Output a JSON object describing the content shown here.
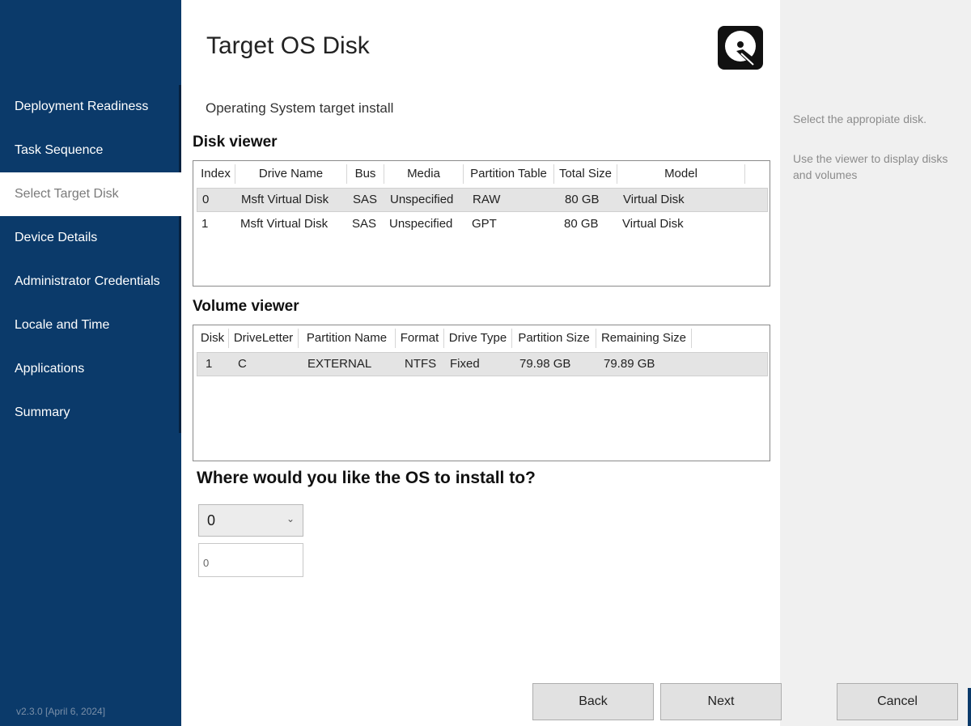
{
  "sidebar": {
    "items": [
      {
        "label": "Deployment Readiness"
      },
      {
        "label": "Task Sequence"
      },
      {
        "label": "Select Target Disk"
      },
      {
        "label": "Device Details"
      },
      {
        "label": "Administrator Credentials"
      },
      {
        "label": "Locale and Time"
      },
      {
        "label": "Applications"
      },
      {
        "label": "Summary"
      }
    ],
    "active_index": 2,
    "version": "v2.3.0 [April 6, 2024]"
  },
  "header": {
    "title": "Target OS Disk",
    "subtitle": "Operating System target install",
    "icon": "hard-disk-icon"
  },
  "disk_viewer": {
    "heading": "Disk viewer",
    "columns": [
      "Index",
      "Drive Name",
      "Bus",
      "Media",
      "Partition Table",
      "Total Size",
      "Model"
    ],
    "rows": [
      [
        "0",
        "Msft Virtual Disk",
        "SAS",
        "Unspecified",
        "RAW",
        "80 GB",
        "Virtual Disk"
      ],
      [
        "1",
        "Msft Virtual Disk",
        "SAS",
        "Unspecified",
        "GPT",
        "80 GB",
        "Virtual Disk"
      ]
    ],
    "selected_row": 0
  },
  "volume_viewer": {
    "heading": "Volume viewer",
    "columns": [
      "Disk",
      "DriveLetter",
      "Partition Name",
      "Format",
      "Drive Type",
      "Partition Size",
      "Remaining Size"
    ],
    "rows": [
      [
        "1",
        "C",
        "EXTERNAL",
        "NTFS",
        "Fixed",
        "79.98 GB",
        "79.89 GB"
      ]
    ],
    "selected_row": 0
  },
  "install_target": {
    "question": "Where would you like the OS to install to?",
    "selected_disk": "0",
    "input_value": "0"
  },
  "help": {
    "line1": "Select the appropiate disk.",
    "line2": "Use the viewer to display disks and volumes"
  },
  "buttons": {
    "back": "Back",
    "next": "Next",
    "cancel": "Cancel"
  },
  "colors": {
    "sidebar_bg": "#0b3a6a",
    "help_bg": "#f0f0f0",
    "button_bg": "#e1e1e1"
  }
}
